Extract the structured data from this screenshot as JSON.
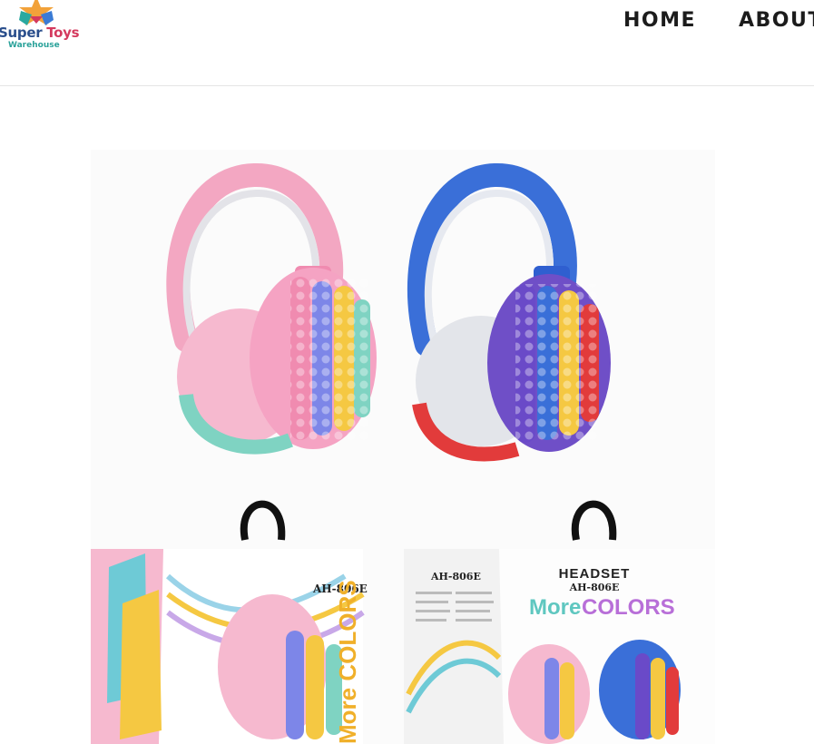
{
  "brand": {
    "name_part1": "Super",
    "name_part2": "Toys",
    "tagline": "Warehouse",
    "colors": {
      "primary": "#2a4e8c",
      "accent": "#d43a5e",
      "teal": "#2ba29a",
      "orange": "#f2a23a"
    }
  },
  "nav": {
    "items": [
      {
        "label": "HOME"
      },
      {
        "label": "ABOUT"
      }
    ]
  },
  "product_image": {
    "description_icon": "headphones-product-photo",
    "box_left": {
      "model": "AH-806E",
      "side_text": "More COLORS"
    },
    "box_right": {
      "model": "AH-806E",
      "title": "HEADSET",
      "model2": "AH-806E",
      "tagline_1": "More",
      "tagline_2": "COLORS"
    }
  }
}
